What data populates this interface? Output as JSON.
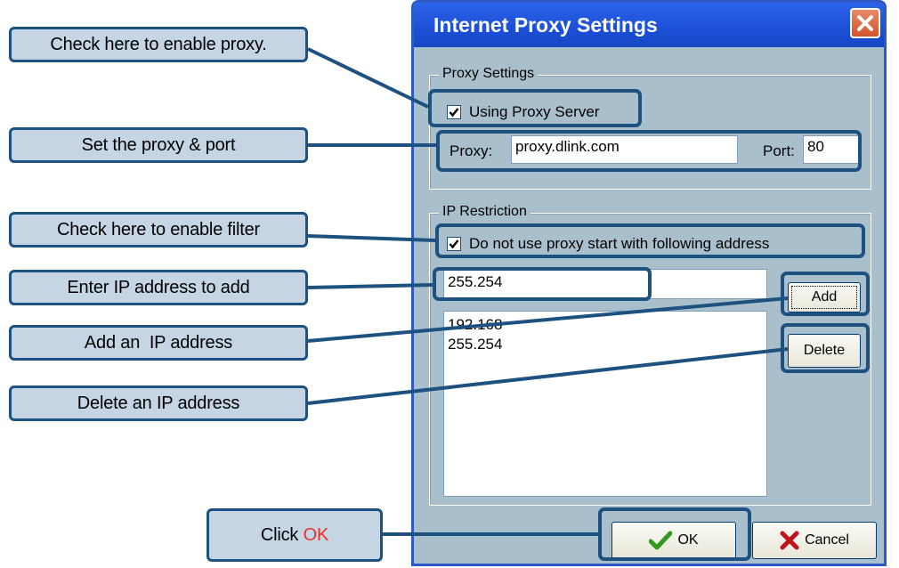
{
  "window": {
    "title": "Internet Proxy Settings",
    "close_icon": "close-icon"
  },
  "proxy_settings": {
    "group_title": "Proxy Settings",
    "using_proxy_label": "Using Proxy Server",
    "using_proxy_checked": true,
    "proxy_label": "Proxy:",
    "proxy_value": "proxy.dlink.com",
    "port_label": "Port:",
    "port_value": "80"
  },
  "ip_restriction": {
    "group_title": "IP Restriction",
    "filter_label": "Do not use proxy start with following address",
    "filter_checked": true,
    "ip_input_value": "255.254",
    "ip_list": [
      "192.168",
      "255.254"
    ],
    "add_label": "Add",
    "delete_label": "Delete"
  },
  "buttons": {
    "ok_label": "OK",
    "cancel_label": "Cancel"
  },
  "callouts": {
    "enable_proxy": "Check here to enable proxy.",
    "set_proxy": "Set the proxy & port",
    "enable_filter": "Check here to enable filter",
    "enter_ip": "Enter IP address to add",
    "add_ip": "Add an  IP address",
    "delete_ip": "Delete an IP address",
    "click_prefix": "Click ",
    "click_ok": "OK"
  },
  "colors": {
    "callout_fill": "#c5d5e4",
    "callout_border": "#1c5180",
    "ok_highlight": "#e8302a",
    "title_bar": "#1c4fd8",
    "dialog_bg": "#a9bfcc"
  }
}
